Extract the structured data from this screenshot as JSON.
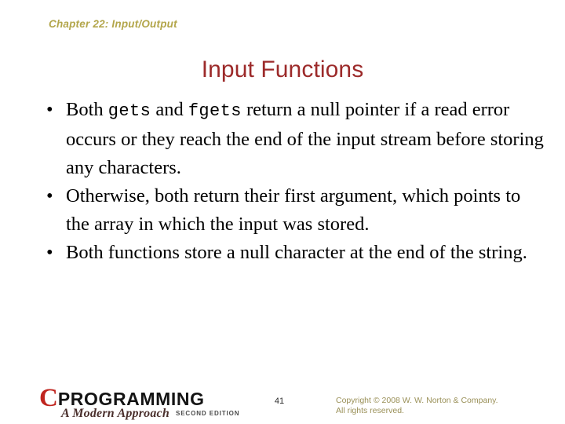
{
  "slide": {
    "chapter_header": "Chapter 22: Input/Output",
    "title": "Input Functions",
    "bullets": [
      {
        "marker": "•",
        "segments": [
          {
            "text": "Both ",
            "style": "normal"
          },
          {
            "text": "gets",
            "style": "mono"
          },
          {
            "text": " and ",
            "style": "normal"
          },
          {
            "text": "fgets",
            "style": "mono"
          },
          {
            "text": " return a null pointer if a read error occurs or they reach the end of the input stream before storing any characters.",
            "style": "normal"
          }
        ],
        "plain_text": "Both gets and fgets return a null pointer if a read error occurs or they reach the end of the input stream before storing any characters."
      },
      {
        "marker": "•",
        "segments": [
          {
            "text": "Otherwise, both return their first argument, which points to the array in which the input was stored.",
            "style": "normal"
          }
        ],
        "plain_text": "Otherwise, both return their first argument, which points to the array in which the input was stored."
      },
      {
        "marker": "•",
        "segments": [
          {
            "text": "Both functions store a null character at the end of the string.",
            "style": "normal"
          }
        ],
        "plain_text": "Both functions store a null character at the end of the string."
      }
    ]
  },
  "footer": {
    "logo": {
      "initial": "C",
      "word": "PROGRAMMING",
      "subtitle": "A Modern Approach",
      "edition": "SECOND EDITION"
    },
    "page_number": "41",
    "copyright_line1": "Copyright © 2008 W. W. Norton & Company.",
    "copyright_line2": "All rights reserved."
  },
  "colors": {
    "title": "#9c2a2a",
    "chapter_header": "#b3a64b",
    "body_text": "#000000",
    "copyright": "#9a9058",
    "logo_c": "#c0251f",
    "background": "#ffffff"
  }
}
